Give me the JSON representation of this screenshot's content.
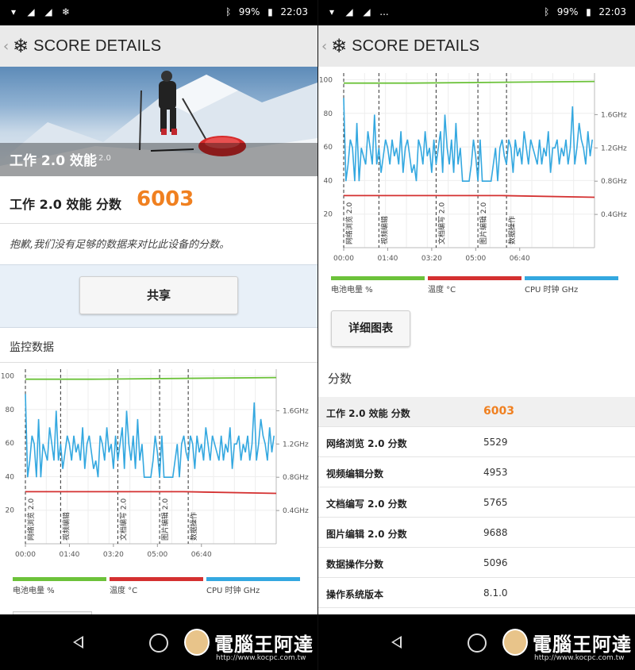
{
  "status": {
    "battery": "99%",
    "time": "22:03",
    "extra": "..."
  },
  "appbar": {
    "title": "SCORE DETAILS"
  },
  "hero": {
    "title": "工作 2.0 效能",
    "version": "2.0"
  },
  "score": {
    "label": "工作 2.0 效能 分数",
    "value": "6003"
  },
  "apology": "抱歉,我们没有足够的数据来对比此设备的分数。",
  "share_label": "共享",
  "monitor_title": "监控数据",
  "detail_label": "详细图表",
  "scores_heading": "分数",
  "colors": {
    "battery": "#6cc23a",
    "temperature": "#d43030",
    "cpu": "#34a8e0",
    "accent": "#f08020"
  },
  "chart_data": {
    "type": "line",
    "y_left_ticks": [
      "20",
      "40",
      "60",
      "80",
      "100"
    ],
    "y_left_range": [
      0,
      104
    ],
    "y_right_ticks": [
      "0.4GHz",
      "0.8GHz",
      "1.2GHz",
      "1.6GHz"
    ],
    "x_ticks": [
      "00:00",
      "01:40",
      "03:20",
      "05:00",
      "06:40"
    ],
    "x_range_seconds": [
      0,
      570
    ],
    "markers": [
      {
        "label": "网络浏览 2.0",
        "t": 0
      },
      {
        "label": "视频编辑",
        "t": 80
      },
      {
        "label": "文档编写 2.0",
        "t": 210
      },
      {
        "label": "图片编辑 2.0",
        "t": 305
      },
      {
        "label": "数据操作",
        "t": 370
      }
    ],
    "series": [
      {
        "name": "电池电量 %",
        "axis": "left",
        "x": [
          0,
          150,
          570
        ],
        "values": [
          98,
          98,
          99
        ]
      },
      {
        "name": "温度 °C",
        "axis": "left",
        "x": [
          0,
          360,
          570
        ],
        "values": [
          31,
          31,
          30
        ]
      },
      {
        "name": "CPU 时钟 GHz",
        "axis": "right",
        "x": [
          0,
          5,
          10,
          15,
          20,
          25,
          30,
          35,
          40,
          45,
          50,
          55,
          60,
          65,
          70,
          75,
          80,
          85,
          90,
          95,
          100,
          105,
          110,
          115,
          120,
          125,
          130,
          135,
          140,
          145,
          150,
          155,
          160,
          165,
          170,
          175,
          180,
          185,
          190,
          195,
          200,
          205,
          210,
          215,
          220,
          225,
          230,
          235,
          240,
          245,
          250,
          255,
          260,
          265,
          270,
          275,
          280,
          285,
          290,
          295,
          300,
          305,
          310,
          315,
          320,
          325,
          330,
          335,
          340,
          345,
          350,
          355,
          360,
          365,
          370,
          375,
          380,
          385,
          390,
          395,
          400,
          405,
          410,
          415,
          420,
          425,
          430,
          435,
          440,
          445,
          450,
          455,
          460,
          465,
          470,
          475,
          480,
          485,
          490,
          495,
          500,
          505,
          510,
          515,
          520,
          525,
          530,
          535,
          540,
          545,
          550,
          555,
          560,
          565
        ],
        "values": [
          1.8,
          0.8,
          1.0,
          1.3,
          1.2,
          0.8,
          1.5,
          0.8,
          1.2,
          1.1,
          1.0,
          1.4,
          1.2,
          1.0,
          1.6,
          1.0,
          1.2,
          0.9,
          1.1,
          1.3,
          1.2,
          1.0,
          1.3,
          1.1,
          1.2,
          1.0,
          1.4,
          0.9,
          1.2,
          1.3,
          1.1,
          0.9,
          1.0,
          0.8,
          1.3,
          1.2,
          1.0,
          1.4,
          1.1,
          1.2,
          0.9,
          1.3,
          1.0,
          1.2,
          1.4,
          0.9,
          1.6,
          1.2,
          1.0,
          1.3,
          0.9,
          1.5,
          1.0,
          1.2,
          0.8,
          0.8,
          0.8,
          0.8,
          1.0,
          1.3,
          1.1,
          0.8,
          1.3,
          0.8,
          0.8,
          0.8,
          0.8,
          0.8,
          1.0,
          1.2,
          0.8,
          1.2,
          1.3,
          1.1,
          1.0,
          1.3,
          1.2,
          0.9,
          1.3,
          1.1,
          1.2,
          1.0,
          1.4,
          1.2,
          1.0,
          1.3,
          1.2,
          1.1,
          1.0,
          1.3,
          1.0,
          1.2,
          1.1,
          1.4,
          0.9,
          1.2,
          1.2,
          1.3,
          1.0,
          1.2,
          1.1,
          1.3,
          1.0,
          1.2,
          1.7,
          1.0,
          1.2,
          1.5,
          1.3,
          1.2,
          1.0,
          1.4,
          1.1,
          1.3
        ]
      }
    ]
  },
  "legend": [
    {
      "label": "电池电量 %"
    },
    {
      "label": "温度 °C"
    },
    {
      "label": "CPU 时钟 GHz"
    }
  ],
  "table": [
    {
      "label": "工作 2.0 效能 分数",
      "value": "6003"
    },
    {
      "label": "网络浏览 2.0 分数",
      "value": "5529"
    },
    {
      "label": "视频编辑分数",
      "value": "4953"
    },
    {
      "label": "文档编写 2.0 分数",
      "value": "5765"
    },
    {
      "label": "图片编辑 2.0 分数",
      "value": "9688"
    },
    {
      "label": "数据操作分数",
      "value": "5096"
    },
    {
      "label": "操作系统版本",
      "value": "8.1.0"
    }
  ],
  "watermark": {
    "text": "電腦王阿達",
    "url": "http://www.kocpc.com.tw"
  }
}
